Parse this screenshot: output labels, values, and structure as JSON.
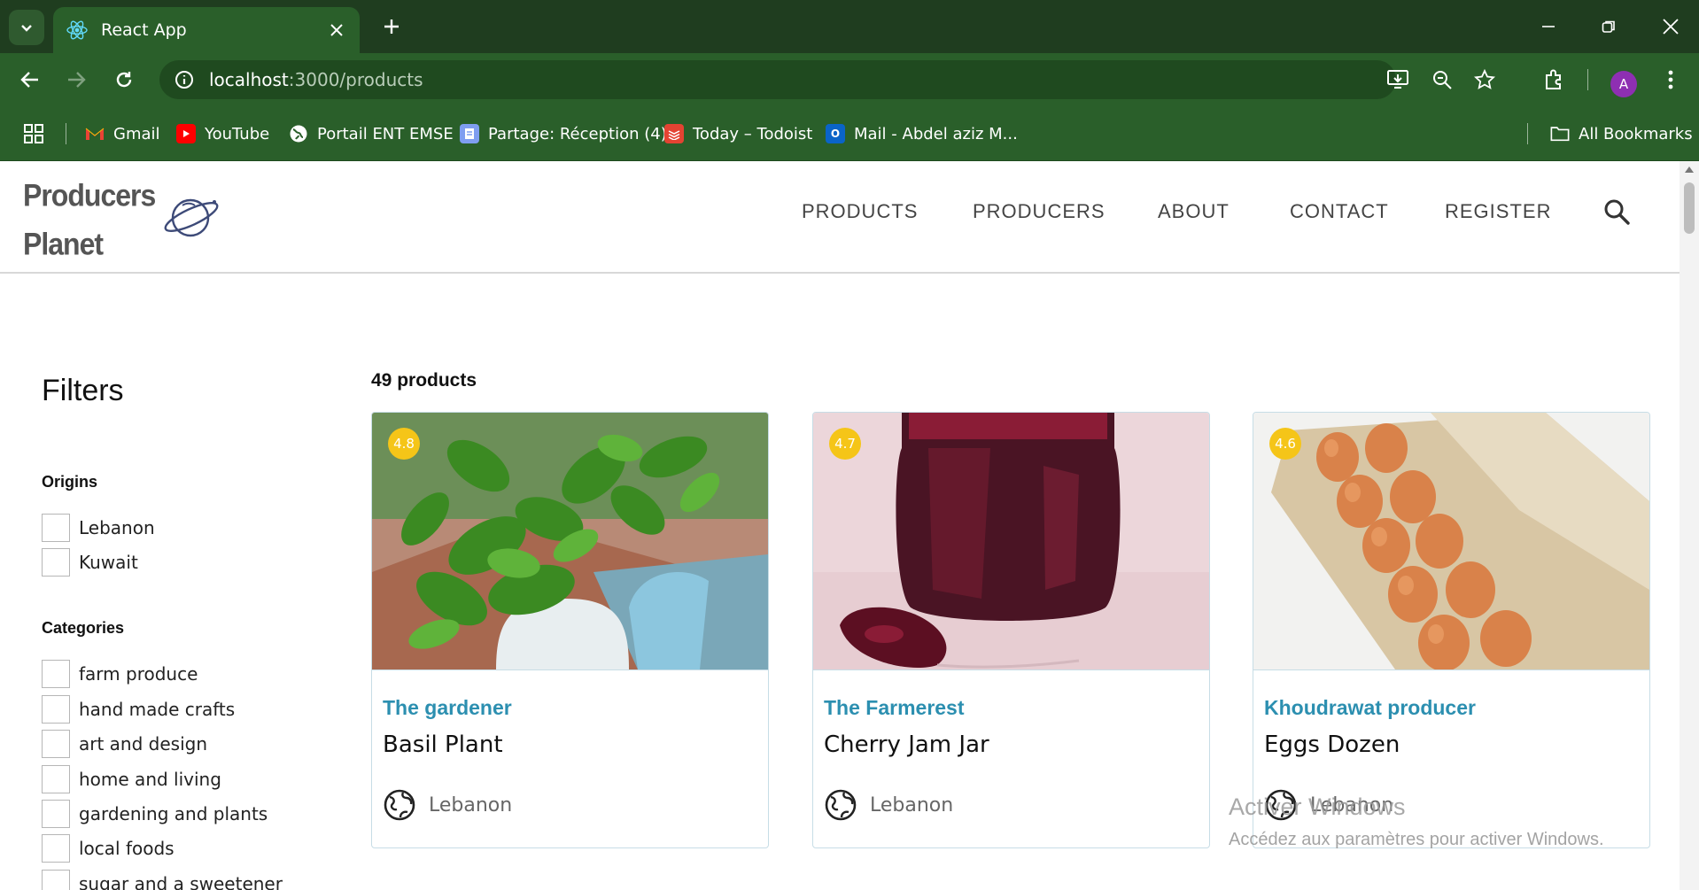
{
  "browser": {
    "tab_title": "React App",
    "url_host": "localhost",
    "url_path": ":3000/products",
    "profile_initial": "A",
    "bookmarks": [
      {
        "label": "Gmail",
        "icon": "gmail-icon"
      },
      {
        "label": "YouTube",
        "icon": "youtube-icon"
      },
      {
        "label": "Portail ENT EMSE",
        "icon": "globe-icon"
      },
      {
        "label": "Partage: Réception (4)",
        "icon": "partage-icon"
      },
      {
        "label": "Today – Todoist",
        "icon": "todoist-icon"
      },
      {
        "label": "Mail - Abdel aziz M...",
        "icon": "outlook-icon"
      }
    ],
    "all_bookmarks_label": "All Bookmarks"
  },
  "site": {
    "logo_line1": "Producers",
    "logo_line2": "Planet",
    "nav": [
      "PRODUCTS",
      "PRODUCERS",
      "ABOUT",
      "CONTACT",
      "REGISTER"
    ]
  },
  "filters": {
    "title": "Filters",
    "origins_title": "Origins",
    "origins": [
      "Lebanon",
      "Kuwait"
    ],
    "categories_title": "Categories",
    "categories": [
      "farm produce",
      "hand made crafts",
      "art and design",
      "home and living",
      "gardening and plants",
      "local foods",
      "sugar and a sweetener"
    ]
  },
  "products": {
    "count_label": "49 products",
    "items": [
      {
        "producer": "The gardener",
        "name": "Basil Plant",
        "origin": "Lebanon",
        "rating": "4.8"
      },
      {
        "producer": "The Farmerest",
        "name": "Cherry Jam Jar",
        "origin": "Lebanon",
        "rating": "4.7"
      },
      {
        "producer": "Khoudrawat producer",
        "name": "Eggs Dozen",
        "origin": "Lebanon",
        "rating": "4.6"
      }
    ]
  },
  "watermark": {
    "title": "Activer Windows",
    "subtitle": "Accédez aux paramètres pour activer Windows."
  },
  "colors": {
    "chrome_dark": "#1f3d1f",
    "chrome": "#2a5f2a",
    "producer_link": "#2c8fb0",
    "rating_badge": "#f5c518"
  }
}
